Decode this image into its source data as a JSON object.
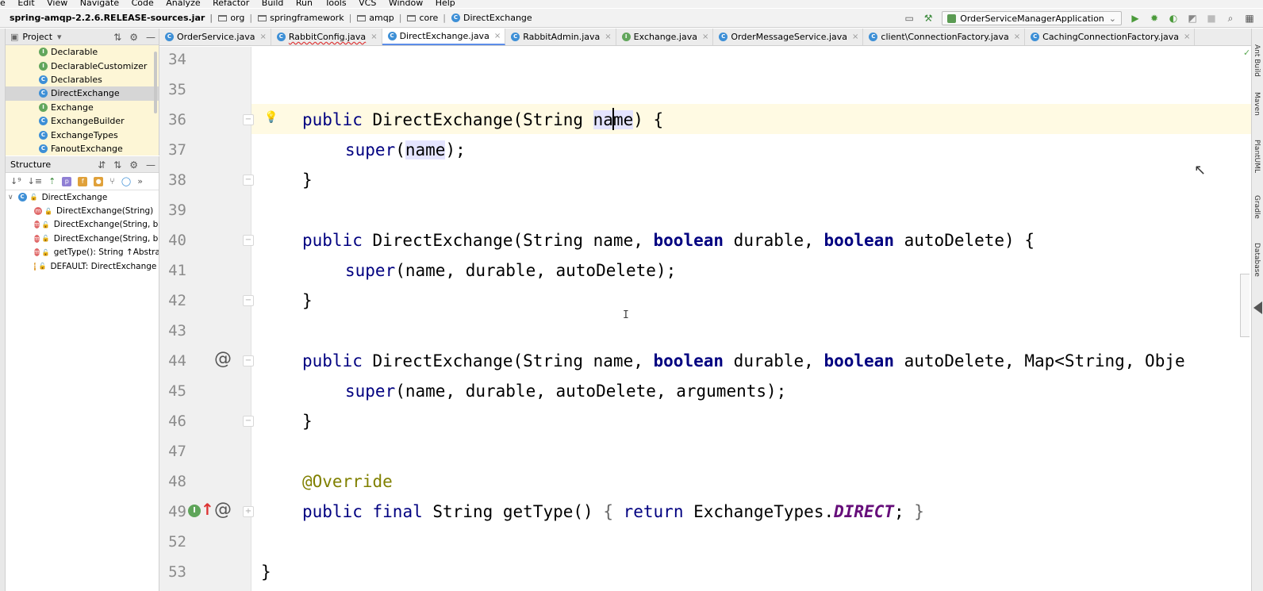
{
  "menu": [
    "le",
    "Edit",
    "View",
    "Navigate",
    "Code",
    "Analyze",
    "Refactor",
    "Build",
    "Run",
    "Tools",
    "VCS",
    "Window",
    "Help"
  ],
  "breadcrumb": {
    "jar": "spring-amqp-2.2.6.RELEASE-sources.jar",
    "parts": [
      "org",
      "springframework",
      "amqp",
      "core"
    ],
    "current": "DirectExchange"
  },
  "run_config": {
    "name": "OrderServiceManagerApplication"
  },
  "project_panel": {
    "title": "Project",
    "items": [
      {
        "icon": "I",
        "label": "Declarable"
      },
      {
        "icon": "I",
        "label": "DeclarableCustomizer"
      },
      {
        "icon": "C",
        "label": "Declarables"
      },
      {
        "icon": "C",
        "label": "DirectExchange",
        "selected": true
      },
      {
        "icon": "I",
        "label": "Exchange"
      },
      {
        "icon": "C",
        "label": "ExchangeBuilder"
      },
      {
        "icon": "C",
        "label": "ExchangeTypes"
      },
      {
        "icon": "C",
        "label": "FanoutExchange"
      }
    ]
  },
  "structure_panel": {
    "title": "Structure",
    "root": "DirectExchange",
    "items": [
      {
        "kind": "m",
        "label": "DirectExchange(String)"
      },
      {
        "kind": "m",
        "label": "DirectExchange(String, boo"
      },
      {
        "kind": "m",
        "label": "DirectExchange(String, boo"
      },
      {
        "kind": "m",
        "label": "getType(): String ↑Abstract"
      },
      {
        "kind": "f",
        "label": "DEFAULT: DirectExchange ="
      }
    ]
  },
  "tabs": [
    {
      "label": "OrderService.java",
      "icon": "C"
    },
    {
      "label": "RabbitConfig.java",
      "icon": "C",
      "error": true
    },
    {
      "label": "DirectExchange.java",
      "icon": "C",
      "active": true
    },
    {
      "label": "RabbitAdmin.java",
      "icon": "C"
    },
    {
      "label": "Exchange.java",
      "icon": "I"
    },
    {
      "label": "OrderMessageService.java",
      "icon": "C"
    },
    {
      "label": "client\\ConnectionFactory.java",
      "icon": "C"
    },
    {
      "label": "CachingConnectionFactory.java",
      "icon": "C"
    }
  ],
  "code": {
    "line_numbers": [
      "34",
      "35",
      "36",
      "37",
      "38",
      "39",
      "40",
      "41",
      "42",
      "43",
      "44",
      "45",
      "46",
      "47",
      "48",
      "49",
      "52",
      "53"
    ],
    "l36_kw": "public",
    "l36_a": " DirectExchange(String ",
    "l36_hl": "name",
    "l36_b": ") {",
    "l37_kw": "super",
    "l37_a": "(",
    "l37_hl": "name",
    "l37_b": ");",
    "l38": "}",
    "l40_kw1": "public",
    "l40_a": " DirectExchange(String name, ",
    "l40_kw2": "boolean",
    "l40_b": " durable, ",
    "l40_kw3": "boolean",
    "l40_c": " autoDelete) {",
    "l41_kw": "super",
    "l41_a": "(name, durable, autoDelete);",
    "l42": "}",
    "l44_kw1": "public",
    "l44_a": " DirectExchange(String name, ",
    "l44_kw2": "boolean",
    "l44_b": " durable, ",
    "l44_kw3": "boolean",
    "l44_c": " autoDelete, Map<String, Obje",
    "l45_kw": "super",
    "l45_a": "(name, durable, autoDelete, arguments);",
    "l46": "}",
    "l48": "@Override",
    "l49_kw1": "public",
    "l49_kw2": "final",
    "l49_a": " String getType() ",
    "l49_b1": "{ ",
    "l49_kw3": "return",
    "l49_c": " ExchangeTypes.",
    "l49_it": "DIRECT",
    "l49_d": "; ",
    "l49_b2": "}",
    "l53": "}"
  },
  "gutter_marks": {
    "at": "@"
  },
  "right_tools": [
    "Ant Build",
    "Maven",
    "PlantUML",
    "Gradle",
    "Database"
  ]
}
